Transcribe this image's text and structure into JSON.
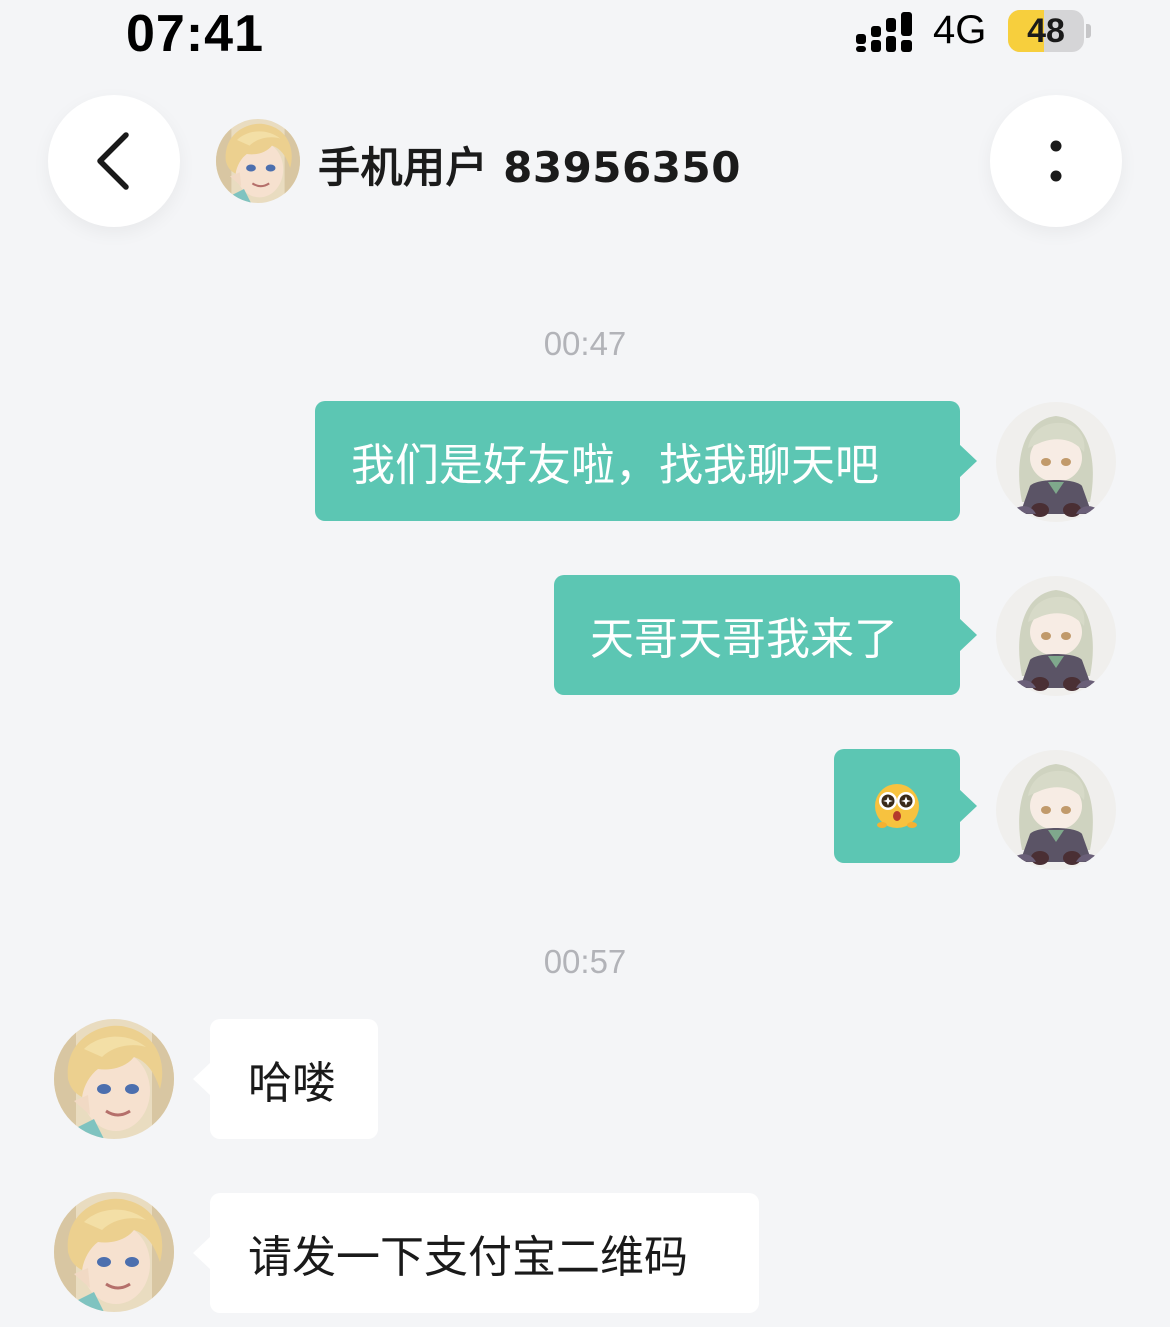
{
  "status_bar": {
    "time": "07:41",
    "network": "4G",
    "battery": "48",
    "battery_level_percent": 48
  },
  "header": {
    "contact_name": "手机用户 83956350",
    "back_icon": "chevron-left-icon",
    "more_icon": "vertical-ellipsis-icon"
  },
  "messages": {
    "timestamp_1": "00:47",
    "out_1": "我们是好友啦，找我聊天吧",
    "out_2": "天哥天哥我来了",
    "out_3_emoji": "starry-eyed-emoji",
    "timestamp_2": "00:57",
    "in_1": "哈喽",
    "in_2": "请发一下支付宝二维码"
  },
  "colors": {
    "background": "#f4f5f7",
    "outgoing_bubble": "#5cc6b3",
    "incoming_bubble": "#ffffff",
    "timestamp_text": "#b2b3b8"
  }
}
